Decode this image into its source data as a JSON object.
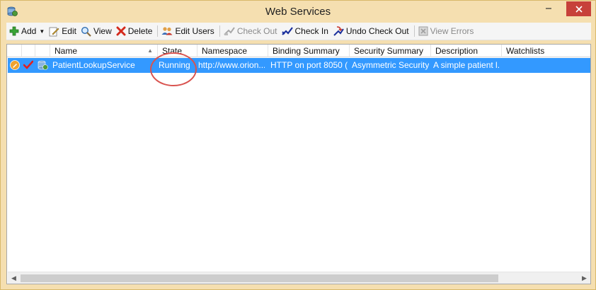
{
  "window": {
    "title": "Web Services",
    "titlebar_color": "#f5dfb0",
    "close_color": "#c7413a"
  },
  "toolbar": {
    "add": "Add",
    "edit": "Edit",
    "view": "View",
    "delete": "Delete",
    "edit_users": "Edit Users",
    "check_out": "Check Out",
    "check_in": "Check In",
    "undo_check_out": "Undo Check Out",
    "view_errors": "View Errors"
  },
  "grid": {
    "columns": [
      "Name",
      "State",
      "Namespace",
      "Binding Summary",
      "Security Summary",
      "Description",
      "Watchlists"
    ],
    "sort_column": "Name",
    "sort_direction": "ascending",
    "rows": [
      {
        "name": "PatientLookupService",
        "state": "Running",
        "namespace": "http://www.orion...",
        "binding": "HTTP on port 8050 (...",
        "security": "Asymmetric Security ...",
        "description": "A simple patient l...",
        "watchlists": "",
        "icons": [
          "edit-pencil-icon",
          "checked-in-icon",
          "web-service-icon"
        ],
        "selected": true
      }
    ],
    "selection_color": "#3399ff"
  },
  "annotation": {
    "color": "#d9534f",
    "target": "Running"
  }
}
